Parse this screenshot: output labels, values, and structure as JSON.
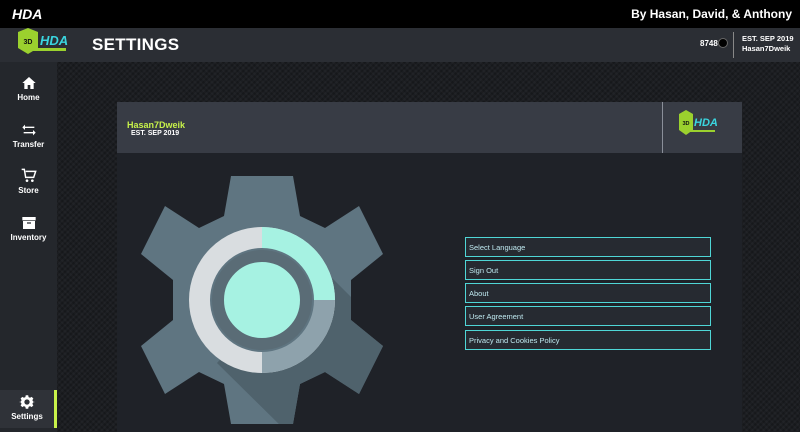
{
  "titlebar": {
    "app_name": "HDA",
    "credits": "By Hasan, David, & Anthony"
  },
  "header": {
    "title": "SETTINGS",
    "coins": "8748",
    "est": "EST. SEP 2019",
    "username": "Hasan7Dweik",
    "logo_text": "HDA"
  },
  "sidebar": {
    "items": [
      {
        "label": "Home",
        "icon": "home-icon"
      },
      {
        "label": "Transfer",
        "icon": "transfer-icon"
      },
      {
        "label": "Store",
        "icon": "cart-icon"
      },
      {
        "label": "Inventory",
        "icon": "archive-icon"
      },
      {
        "label": "Settings",
        "icon": "gear-icon",
        "active": true
      }
    ]
  },
  "panel": {
    "username": "Hasan7Dweik",
    "est": "EST. SEP 2019",
    "menu": [
      "Select Language",
      "Sign Out",
      "About",
      "User Agreement",
      "Privacy and Cookies Policy"
    ]
  },
  "colors": {
    "accent": "#c8f24a",
    "cyan": "#4fd6d6",
    "gear": "#5f7581"
  }
}
